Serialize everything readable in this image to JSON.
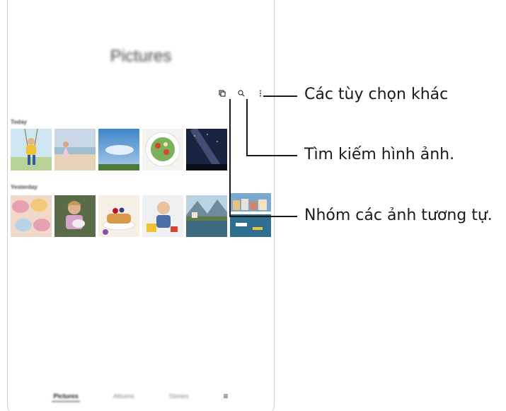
{
  "app": {
    "title": "Pictures"
  },
  "toolbar": {
    "icons": [
      "group-similar-icon",
      "search-icon",
      "more-options-icon"
    ]
  },
  "sections": [
    {
      "label": "Today",
      "photos": [
        "boy-on-swing",
        "girl-on-beach",
        "sky-landscape",
        "salad-plate",
        "night-sky-milky-way"
      ]
    },
    {
      "label": "Yesterday",
      "photos": [
        "macarons",
        "girl-with-cat",
        "pancakes-berries",
        "baby-with-toy",
        "lake-village",
        "grouped-coastal-town"
      ]
    }
  ],
  "bottom_nav": {
    "tabs": [
      "Pictures",
      "Albums",
      "Stories"
    ],
    "active": "Pictures",
    "menu_glyph": "≡"
  },
  "callouts": {
    "more_options": "Các tùy chọn khác",
    "search": "Tìm kiếm hình ảnh.",
    "group_similar": "Nhóm các ảnh tương tự."
  }
}
